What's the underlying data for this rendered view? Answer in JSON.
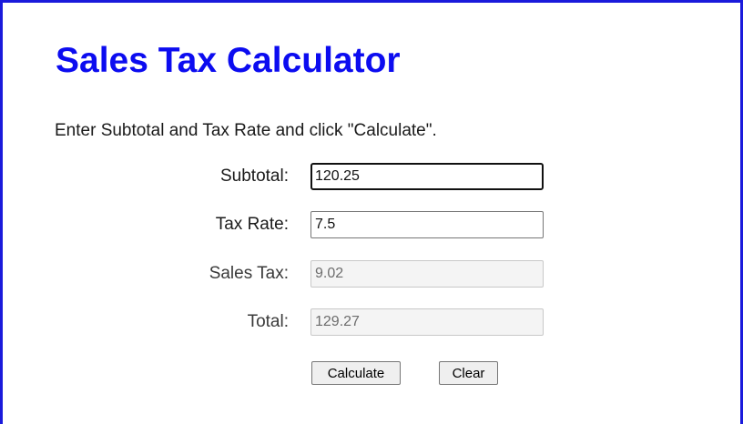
{
  "page": {
    "title": "Sales Tax Calculator",
    "instructions": "Enter Subtotal and Tax Rate and click \"Calculate\"."
  },
  "form": {
    "subtotal": {
      "label": "Subtotal:",
      "value": "120.25"
    },
    "tax_rate": {
      "label": "Tax Rate:",
      "value": "7.5"
    },
    "sales_tax": {
      "label": "Sales Tax:",
      "value": "9.02"
    },
    "total": {
      "label": "Total:",
      "value": "129.27"
    }
  },
  "buttons": {
    "calculate_label": "Calculate",
    "clear_label": "Clear"
  },
  "colors": {
    "accent": "#0c0cf0",
    "frame": "#1a1adb"
  }
}
